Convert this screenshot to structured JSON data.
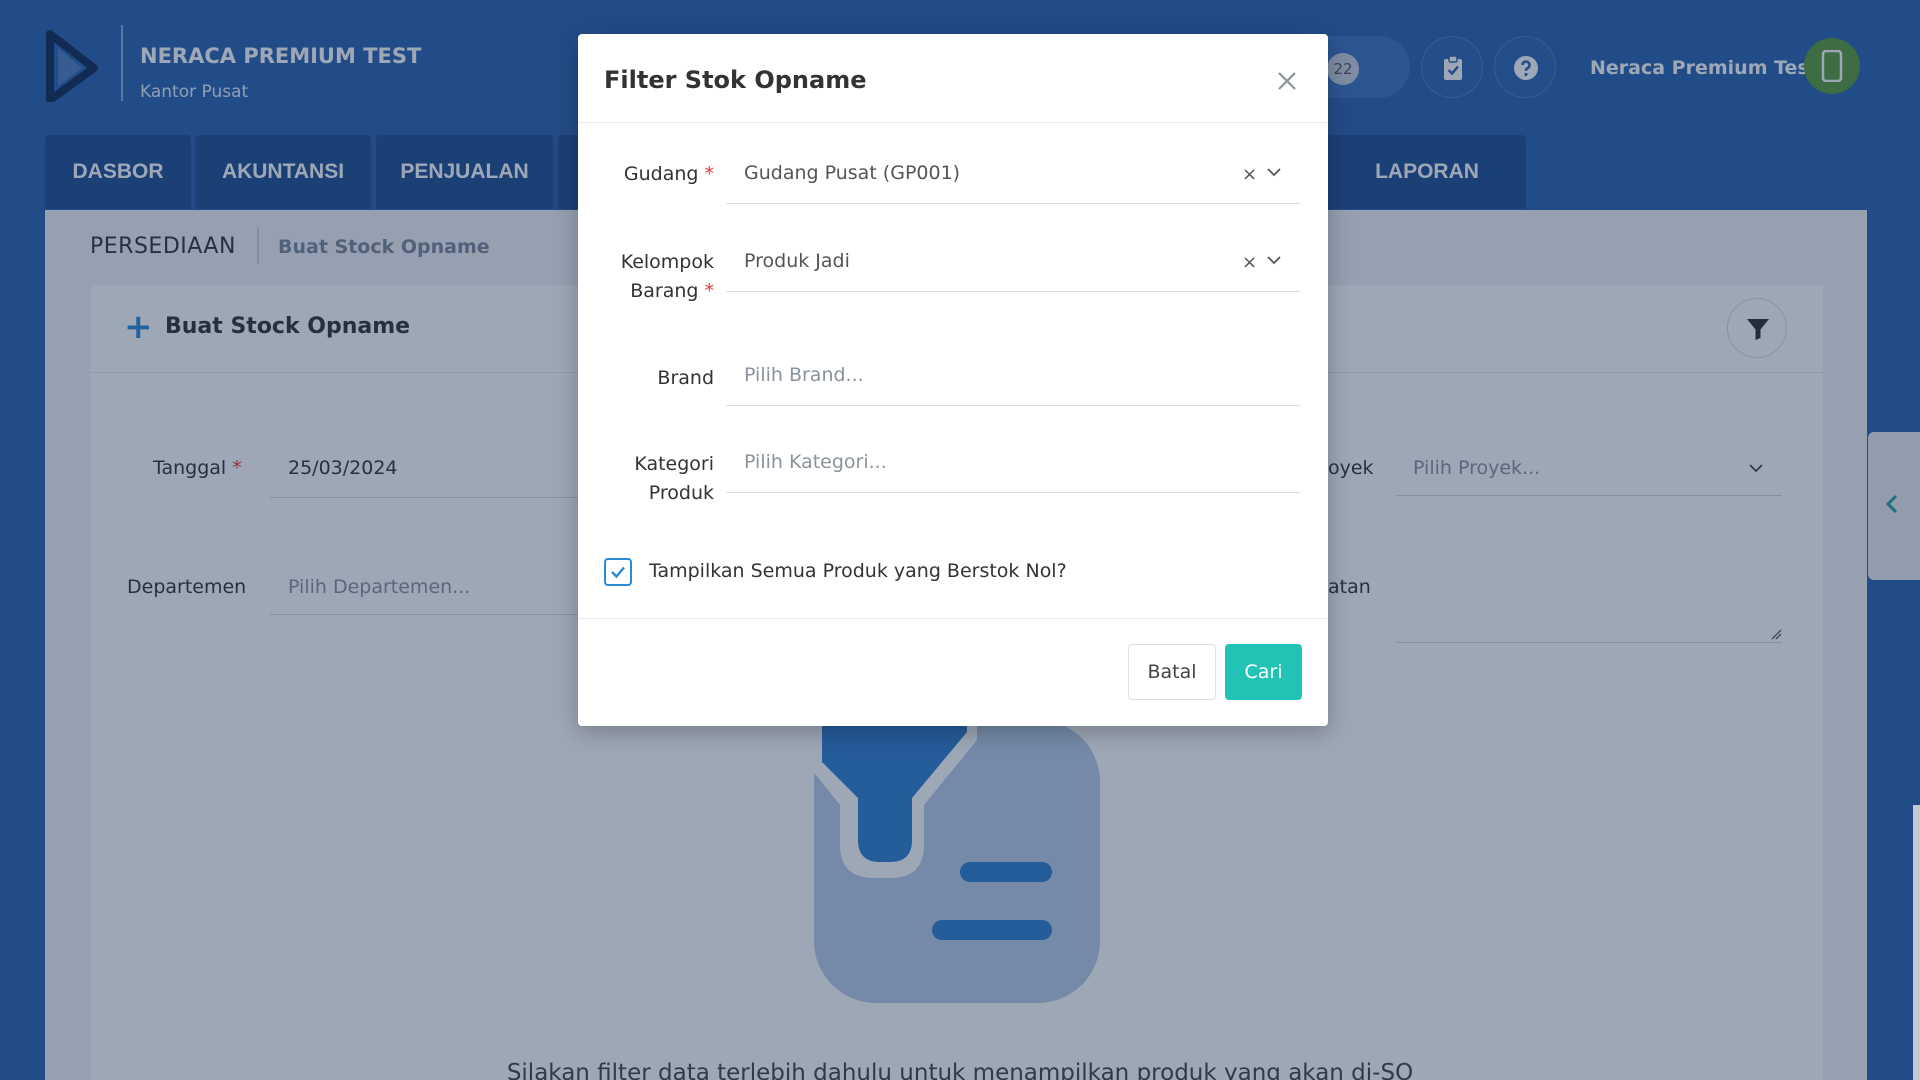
{
  "header": {
    "company_name": "NERACA PREMIUM TEST",
    "branch": "Kantor Pusat",
    "notif_count": "22",
    "user_name": "Neraca Premium Test"
  },
  "nav": {
    "tabs": [
      {
        "label": "DASBOR"
      },
      {
        "label": "AKUNTANSI"
      },
      {
        "label": "PENJUALAN"
      },
      {
        "label": "LAPORAN"
      }
    ]
  },
  "breadcrumb": {
    "main": "PERSEDIAAN",
    "sub": "Buat Stock Opname"
  },
  "card": {
    "title": "Buat Stock Opname"
  },
  "form": {
    "tanggal_label": "Tanggal",
    "tanggal_value": "25/03/2024",
    "departemen_label": "Departemen",
    "departemen_placeholder": "Pilih Departemen...",
    "proyek_label_partial": "oyek",
    "proyek_placeholder": "Pilih Proyek...",
    "catatan_label_partial": "atan",
    "required_mark": "*"
  },
  "empty_state": {
    "message": "Silakan filter data terlebih dahulu untuk menampilkan produk yang akan di-SO"
  },
  "modal": {
    "title": "Filter Stok Opname",
    "fields": {
      "gudang": {
        "label": "Gudang",
        "value": "Gudang Pusat (GP001)",
        "clear": "×"
      },
      "kelompok": {
        "label_1": "Kelompok",
        "label_2": "Barang",
        "value": "Produk Jadi",
        "clear": "×"
      },
      "brand": {
        "label": "Brand",
        "placeholder": "Pilih Brand..."
      },
      "kategori": {
        "label_1": "Kategori",
        "label_2": "Produk",
        "placeholder": "Pilih Kategori..."
      }
    },
    "checkbox_label": "Tampilkan Semua Produk yang Berstok Nol?",
    "checkbox_checked": true,
    "cancel_label": "Batal",
    "submit_label": "Cari"
  },
  "colors": {
    "brand_blue": "#2a63b0",
    "nav_tab": "#1e4f92",
    "accent_teal": "#22c3b4",
    "accent_blue": "#2a8ad4"
  }
}
